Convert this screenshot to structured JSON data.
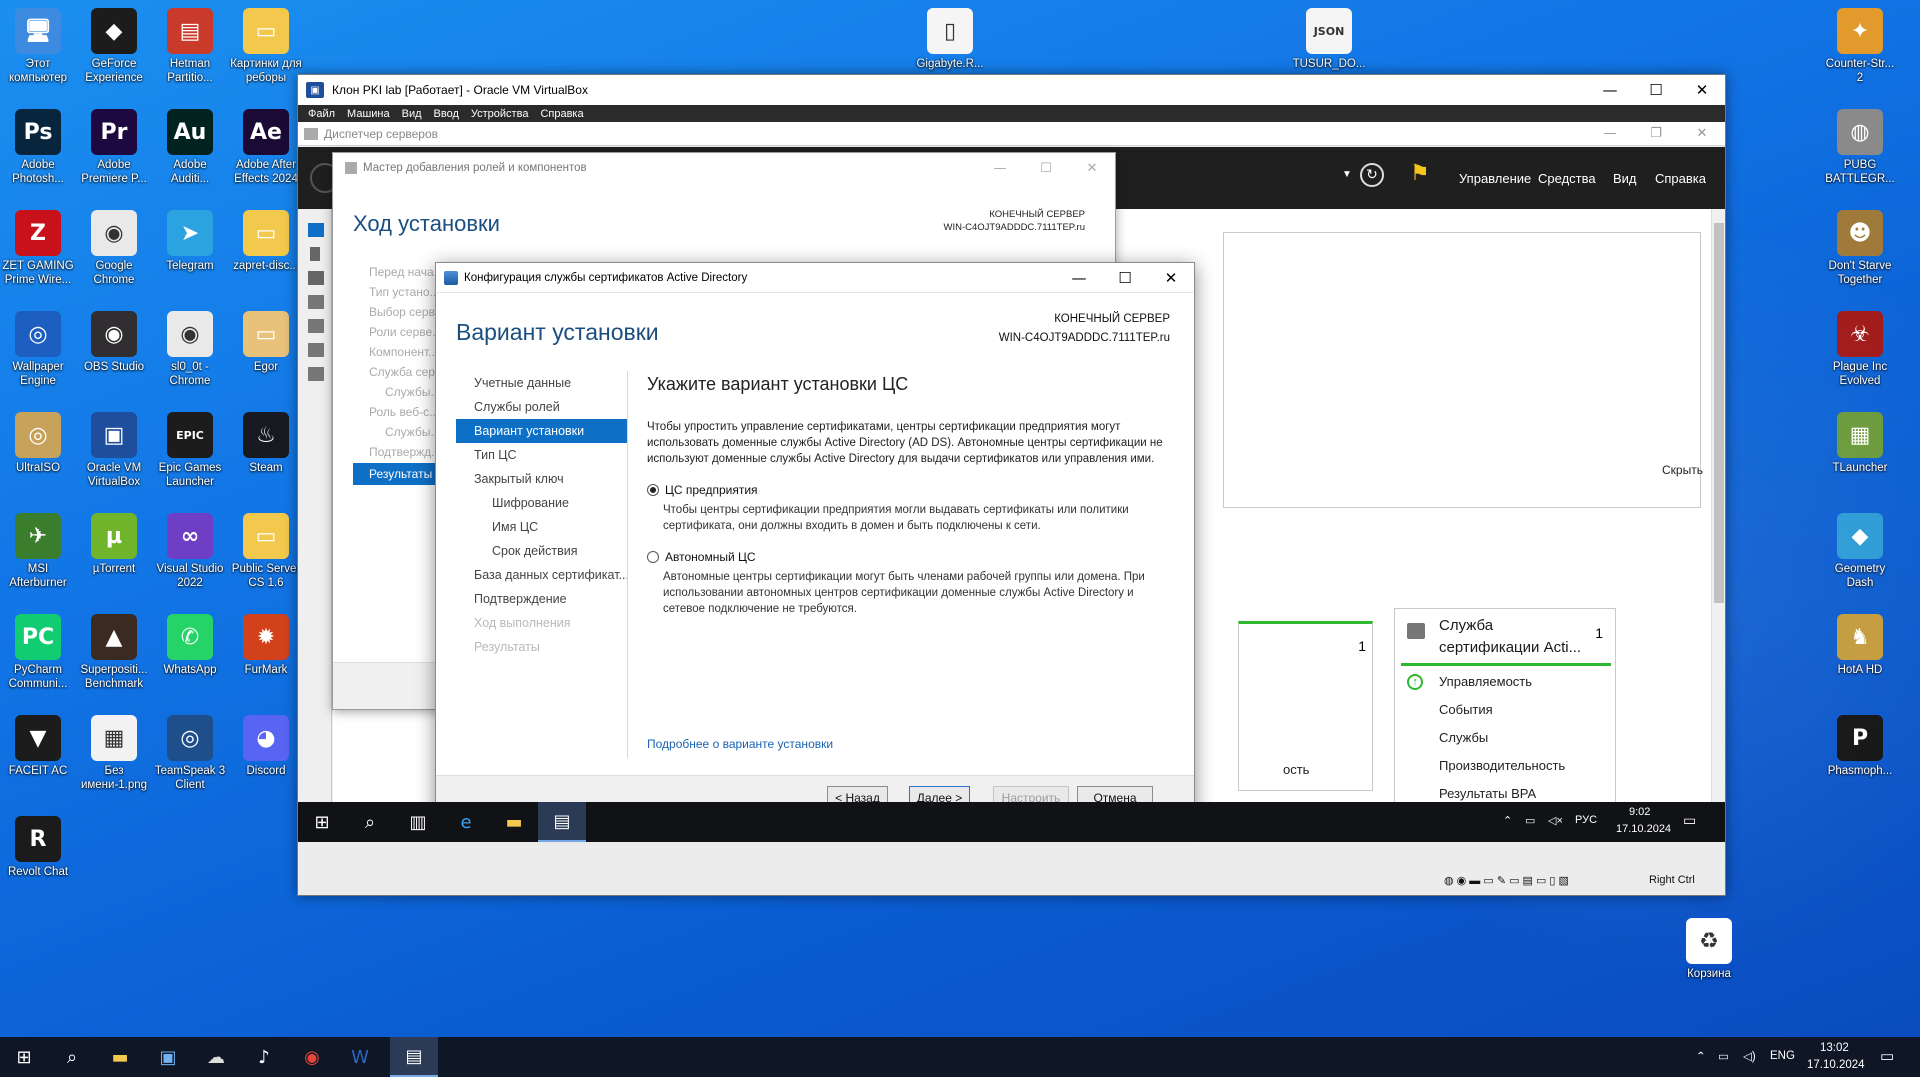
{
  "desktop": {
    "icons_left": [
      {
        "label": "Этот компьютер",
        "glyph": "🖥",
        "bg": "#3c8be0"
      },
      {
        "label": "GeForce Experience",
        "glyph": "◆",
        "bg": "#1c1c1c"
      },
      {
        "label": "Hetman Partitio...",
        "glyph": "▤",
        "bg": "#c93a2a"
      },
      {
        "label": "Картинки для реборы",
        "glyph": "▭",
        "bg": "#f2c94c"
      },
      {
        "label": "Adobe Photosh...",
        "glyph": "Ps",
        "bg": "#07253d"
      },
      {
        "label": "Adobe Premiere P...",
        "glyph": "Pr",
        "bg": "#1d0840"
      },
      {
        "label": "Adobe Auditi...",
        "glyph": "Au",
        "bg": "#01221f"
      },
      {
        "label": "Adobe After Effects 2024",
        "glyph": "Ae",
        "bg": "#1a0a35"
      },
      {
        "label": "ZET GAMING Prime Wire...",
        "glyph": "Z",
        "bg": "#c8111b"
      },
      {
        "label": "Google Chrome",
        "glyph": "◉",
        "bg": "#e9e9e9"
      },
      {
        "label": "Telegram",
        "glyph": "➤",
        "bg": "#2aa3e0"
      },
      {
        "label": "zapret-disc...",
        "glyph": "▭",
        "bg": "#f2c94c"
      },
      {
        "label": "Wallpaper Engine",
        "glyph": "◎",
        "bg": "#1d5ec1"
      },
      {
        "label": "OBS Studio",
        "glyph": "◉",
        "bg": "#302e31"
      },
      {
        "label": "sl0_0t - Chrome",
        "glyph": "◉",
        "bg": "#e9e9e9"
      },
      {
        "label": "Egor",
        "glyph": "▭",
        "bg": "#e8c27a"
      },
      {
        "label": "UltraISO",
        "glyph": "◎",
        "bg": "#c7a25a"
      },
      {
        "label": "Oracle VM VirtualBox",
        "glyph": "▣",
        "bg": "#1f4e9c"
      },
      {
        "label": "Epic Games Launcher",
        "glyph": "EPIC",
        "bg": "#1c1c1c"
      },
      {
        "label": "Steam",
        "glyph": "♨",
        "bg": "#171a21"
      },
      {
        "label": "MSI Afterburner",
        "glyph": "✈",
        "bg": "#3a7d2c"
      },
      {
        "label": "µTorrent",
        "glyph": "µ",
        "bg": "#70b42b"
      },
      {
        "label": "Visual Studio 2022",
        "glyph": "∞",
        "bg": "#6e3ec4"
      },
      {
        "label": "Public Server CS 1.6",
        "glyph": "▭",
        "bg": "#f2c94c"
      },
      {
        "label": "PyCharm Communi...",
        "glyph": "PC",
        "bg": "#12cc71"
      },
      {
        "label": "Superpositi... Benchmark",
        "glyph": "▲",
        "bg": "#3a2a22"
      },
      {
        "label": "WhatsApp",
        "glyph": "✆",
        "bg": "#25d366"
      },
      {
        "label": "FurMark",
        "glyph": "✹",
        "bg": "#d3411c"
      },
      {
        "label": "FACEIT AC",
        "glyph": "▼",
        "bg": "#1c1c1c"
      },
      {
        "label": "Без имени-1.png",
        "glyph": "▦",
        "bg": "#f2f2f2"
      },
      {
        "label": "TeamSpeak 3 Client",
        "glyph": "◎",
        "bg": "#1e4f8a"
      },
      {
        "label": "Discord",
        "glyph": "◕",
        "bg": "#5865f2"
      },
      {
        "label": "Revolt Chat",
        "glyph": "R",
        "bg": "#1b1b1b"
      }
    ],
    "icons_top": [
      {
        "label": "Gigabyte.R...",
        "glyph": "▯",
        "bg": "#f5f5f5"
      },
      {
        "label": "TUSUR_DO...",
        "glyph": "JSON",
        "bg": "#f5f5f5"
      }
    ],
    "icons_right": [
      {
        "label": "Counter-Str... 2",
        "glyph": "✦",
        "bg": "#e29a2c"
      },
      {
        "label": "PUBG BATTLEGR...",
        "glyph": "◍",
        "bg": "#8a8a8a"
      },
      {
        "label": "Don't Starve Together",
        "glyph": "☻",
        "bg": "#a07a3a"
      },
      {
        "label": "Plague Inc Evolved",
        "glyph": "☣",
        "bg": "#a11a1a"
      },
      {
        "label": "TLauncher",
        "glyph": "▦",
        "bg": "#6a9a3a"
      },
      {
        "label": "Geometry Dash",
        "glyph": "◆",
        "bg": "#2a9ad6"
      },
      {
        "label": "HotA HD",
        "glyph": "♞",
        "bg": "#c49a3a"
      },
      {
        "label": "Phasmoph...",
        "glyph": "P",
        "bg": "#121212"
      },
      {
        "label": "Корзина",
        "glyph": "♻",
        "bg": "#ffffff"
      }
    ]
  },
  "vbox": {
    "title": "Клон PKI lab [Работает] - Oracle VM VirtualBox",
    "menu": [
      "Файл",
      "Машина",
      "Вид",
      "Ввод",
      "Устройства",
      "Справка"
    ],
    "status_right": "Right Ctrl"
  },
  "server_manager": {
    "title": "Диспетчер серверов",
    "menu": [
      "Управление",
      "Средства",
      "Вид",
      "Справка"
    ],
    "hide_label": "Скрыть",
    "tile_left_count": "1",
    "tile_left_partial": "ость",
    "tile": {
      "title_line1": "Служба",
      "title_line2": "сертификации Acti...",
      "count": "1",
      "items": [
        "Управляемость",
        "События",
        "Службы",
        "Производительность",
        "Результаты BPA"
      ]
    }
  },
  "wizard": {
    "title": "Мастер добавления ролей и компонентов",
    "heading": "Ход установки",
    "server_label": "КОНЕЧНЫЙ СЕРВЕР",
    "server_name": "WIN-C4OJT9ADDDC.7111TEP.ru",
    "nav": [
      "Перед нача...",
      "Тип устано...",
      "Выбор серв...",
      "Роли серве...",
      "Компонент...",
      "Служба сер...",
      "Службы...",
      "Роль веб-с...",
      "Службы...",
      "Подтвержд...",
      "Результаты"
    ]
  },
  "adcs": {
    "title": "Конфигурация службы сертификатов Active Directory",
    "heading": "Вариант установки",
    "server_label": "КОНЕЧНЫЙ СЕРВЕР",
    "server_name": "WIN-C4OJT9ADDDC.7111TEP.ru",
    "nav": [
      {
        "label": "Учетные данные",
        "state": "normal",
        "sub": false
      },
      {
        "label": "Службы ролей",
        "state": "normal",
        "sub": false
      },
      {
        "label": "Вариант установки",
        "state": "current",
        "sub": false
      },
      {
        "label": "Тип ЦС",
        "state": "normal",
        "sub": false
      },
      {
        "label": "Закрытый ключ",
        "state": "normal",
        "sub": false
      },
      {
        "label": "Шифрование",
        "state": "normal",
        "sub": true
      },
      {
        "label": "Имя ЦС",
        "state": "normal",
        "sub": true
      },
      {
        "label": "Срок действия",
        "state": "normal",
        "sub": true
      },
      {
        "label": "База данных сертификат...",
        "state": "normal",
        "sub": false
      },
      {
        "label": "Подтверждение",
        "state": "normal",
        "sub": false
      },
      {
        "label": "Ход выполнения",
        "state": "disabled",
        "sub": false
      },
      {
        "label": "Результаты",
        "state": "disabled",
        "sub": false
      }
    ],
    "section_title": "Укажите вариант установки ЦС",
    "intro": "Чтобы упростить управление сертификатами, центры сертификации предприятия могут использовать доменные службы Active Directory (AD DS). Автономные центры сертификации не используют доменные службы Active Directory для выдачи сертификатов или управления ими.",
    "option1_label": "ЦС предприятия",
    "option1_desc": "Чтобы центры сертификации предприятия могли выдавать сертификаты или политики сертификата, они должны входить в домен и быть подключены к сети.",
    "option2_label": "Автономный ЦС",
    "option2_desc": "Автономные центры сертификации могут быть членами рабочей группы или домена. При использовании автономных центров сертификации доменные службы Active Directory и сетевое подключение не требуются.",
    "more_link": "Подробнее о варианте установки",
    "buttons": {
      "back": "< Назад",
      "next": "Далее >",
      "configure": "Настроить",
      "cancel": "Отмена"
    }
  },
  "guest_taskbar": {
    "lang": "РУС",
    "time": "9:02",
    "date": "17.10.2024"
  },
  "host_taskbar": {
    "lang": "ENG",
    "time": "13:02",
    "date": "17.10.2024"
  }
}
